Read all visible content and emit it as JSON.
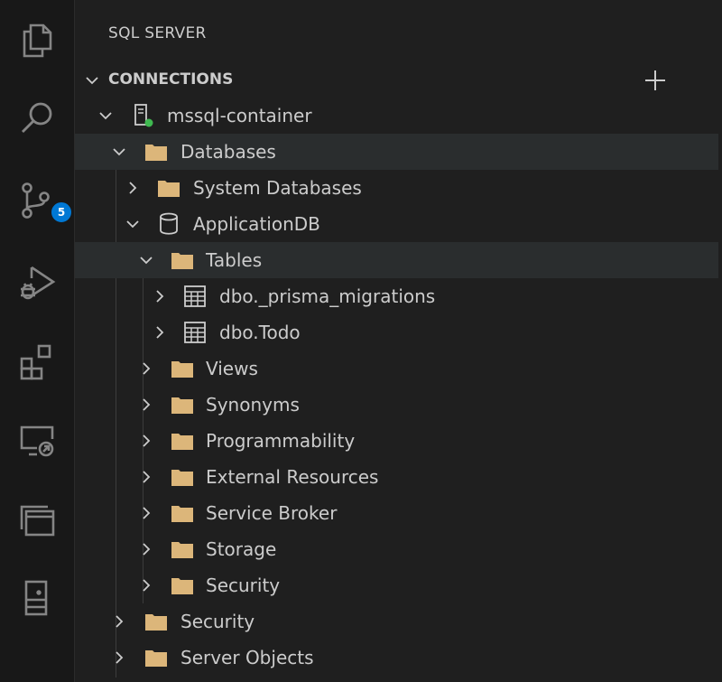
{
  "sidebar": {
    "title": "SQL SERVER",
    "section": "CONNECTIONS",
    "add_icon": "plus-icon"
  },
  "activity_bar": {
    "items": [
      "explorer-icon",
      "search-icon",
      "source-control-icon",
      "run-debug-icon",
      "extensions-icon",
      "remote-explorer-icon",
      "sql-server-icon",
      "database-icon"
    ],
    "source_control_badge": "5"
  },
  "tree": {
    "server": "mssql-container",
    "databases": "Databases",
    "system_databases": "System Databases",
    "application_db": "ApplicationDB",
    "tables": "Tables",
    "table_1": "dbo._prisma_migrations",
    "table_2": "dbo.Todo",
    "views": "Views",
    "synonyms": "Synonyms",
    "programmability": "Programmability",
    "external_resources": "External Resources",
    "service_broker": "Service Broker",
    "storage": "Storage",
    "db_security": "Security",
    "server_security": "Security",
    "server_objects": "Server Objects"
  },
  "colors": {
    "folder": "#dcb67a",
    "status_connected": "#3fb950",
    "badge": "#0078d4",
    "row_highlight": "#2a2d2e"
  }
}
